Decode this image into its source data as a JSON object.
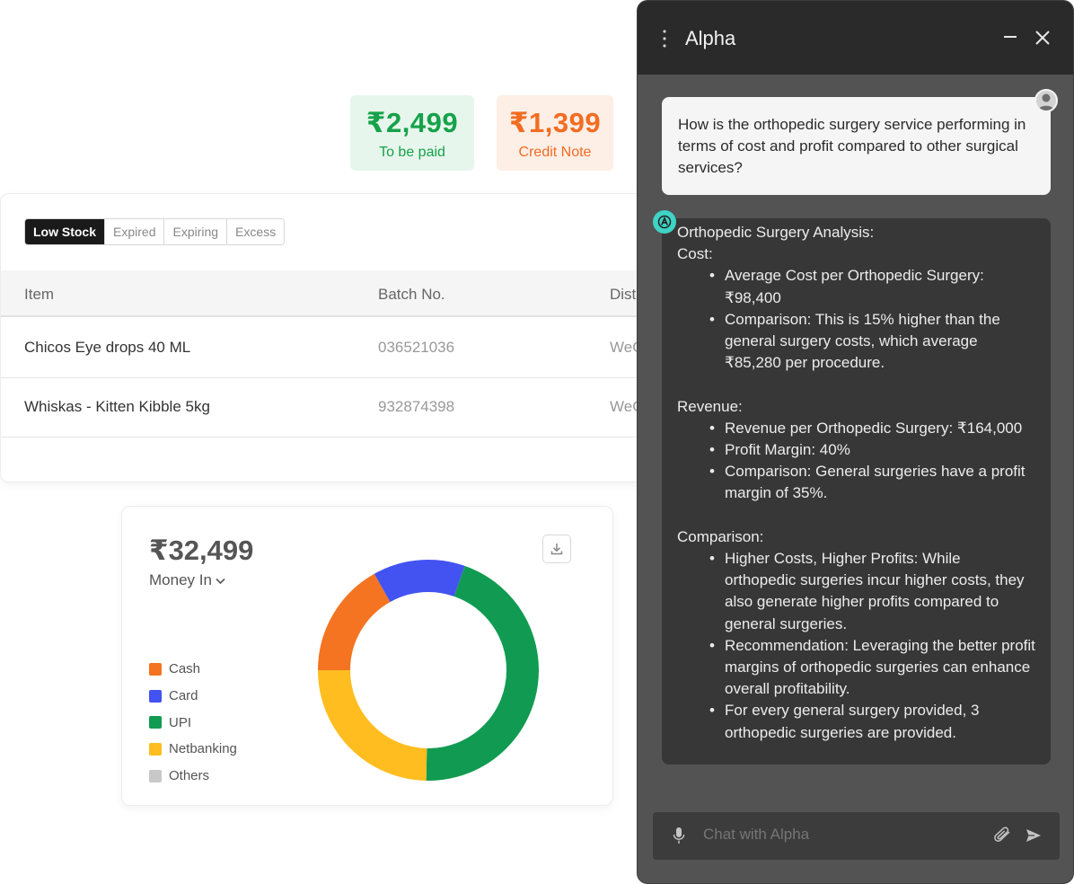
{
  "summary": {
    "to_be_paid": {
      "amount": "₹2,499",
      "label": "To be paid",
      "color": "#15a24a"
    },
    "credit_note": {
      "amount": "₹1,399",
      "label": "Credit Note",
      "color": "#f26c21"
    }
  },
  "inventory": {
    "tabs": [
      {
        "label": "Low Stock",
        "active": true
      },
      {
        "label": "Expired",
        "active": false
      },
      {
        "label": "Expiring",
        "active": false
      },
      {
        "label": "Excess",
        "active": false
      }
    ],
    "columns": [
      "Item",
      "Batch No.",
      "Dist"
    ],
    "rows": [
      {
        "item": "Chicos Eye drops 40 ML",
        "batch": "036521036",
        "dist": "WeC"
      },
      {
        "item": "Whiskas - Kitten Kibble 5kg",
        "batch": "932874398",
        "dist": "WeC"
      }
    ]
  },
  "money": {
    "amount": "₹32,499",
    "selector": "Money In",
    "download_icon": "download-icon"
  },
  "chart_data": {
    "type": "pie",
    "style": "donut",
    "categories": [
      "Cash",
      "Card",
      "UPI",
      "Netbanking",
      "Others"
    ],
    "values": [
      15,
      12,
      40,
      22,
      0
    ],
    "colors": [
      "#f47422",
      "#4353f2",
      "#119b52",
      "#ffbd1f",
      "#c8c8c8"
    ],
    "legend_position": "left"
  },
  "chat": {
    "title": "Alpha",
    "user_message": "How is the orthopedic surgery service performing in terms of cost and profit compared to other surgical services?",
    "response": {
      "heading": "Orthopedic Surgery Analysis:",
      "sections": [
        {
          "title": "Cost:",
          "bullets": [
            "Average Cost per Orthopedic Surgery: ₹98,400",
            "Comparison: This is 15% higher than the general surgery costs, which average ₹85,280 per procedure."
          ]
        },
        {
          "title": "Revenue:",
          "bullets": [
            "Revenue per Orthopedic Surgery: ₹164,000",
            "Profit Margin: 40%",
            "Comparison: General surgeries have a profit margin of 35%."
          ]
        },
        {
          "title": "Comparison:",
          "bullets": [
            "Higher Costs, Higher Profits: While orthopedic surgeries incur higher costs, they also generate higher profits compared to general surgeries.",
            "Recommendation: Leveraging the better profit margins of orthopedic surgeries can enhance overall profitability.",
            "For every general surgery provided, 3 orthopedic surgeries are provided."
          ]
        }
      ]
    },
    "input_placeholder": "Chat with Alpha",
    "accent_color": "#3fd3c4"
  }
}
